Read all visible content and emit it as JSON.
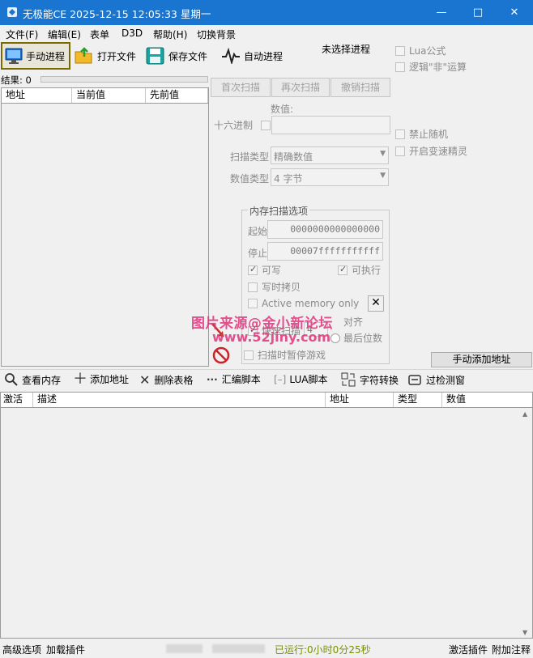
{
  "window": {
    "title": "无极能CE   2025-12-15 12:05:33 星期一",
    "minimize": "—",
    "maximize": "□",
    "close": "✕"
  },
  "menu": [
    "文件(F)",
    "编辑(E)",
    "表单",
    "D3D",
    "帮助(H)",
    "切换背景"
  ],
  "toolbar": {
    "manual_process": "手动进程",
    "open_file": "打开文件",
    "save_file": "保存文件",
    "auto_process": "自动进程",
    "process_status": "未选择进程"
  },
  "options_right": {
    "lua_formula": "Lua公式",
    "logic_not": "逻辑\"非\"运算",
    "disable_random": "禁止随机",
    "enable_speedhack": "开启变速精灵"
  },
  "results": {
    "label": "结果: 0"
  },
  "results_table": {
    "columns": [
      "地址",
      "当前值",
      "先前值"
    ]
  },
  "scan_buttons": {
    "first_scan": "首次扫描",
    "next_scan": "再次扫描",
    "undo_scan": "撤销扫描"
  },
  "scan": {
    "value_label": "数值:",
    "hex_label": "十六进制",
    "scan_type_label": "扫描类型",
    "scan_type_value": "精确数值",
    "value_type_label": "数值类型",
    "value_type_value": "4 字节"
  },
  "memory_options": {
    "legend": "内存扫描选项",
    "start_label": "起始",
    "start_value": "0000000000000000",
    "stop_label": "停止",
    "stop_value": "00007fffffffffff",
    "writable": "可写",
    "executable": "可执行",
    "copy_on_write": "写时拷贝",
    "active_memory": "Active memory only",
    "fast_scan": "快速扫描",
    "fast_scan_value": "4",
    "align": "对齐",
    "last_digits": "最后位数",
    "pause_game": "扫描时暂停游戏"
  },
  "add_manual": "手动添加地址",
  "watermark": {
    "line1": "图片来源@金小新论坛",
    "line2": "www.52jiny.com"
  },
  "bottom_toolbar": {
    "view_memory": "查看内存",
    "add_address": "添加地址",
    "delete_table": "删除表格",
    "asm_script": "汇编脚本",
    "lua_script": "LUA脚本",
    "char_convert": "字符转换",
    "bypass_detect": "过检测窗"
  },
  "address_table": {
    "columns": [
      "激活",
      "描述",
      "地址",
      "类型",
      "数值"
    ]
  },
  "statusbar": {
    "advanced": "高级选项",
    "load_plugin": "加载插件",
    "runtime": "已运行:0小时0分25秒",
    "activate_plugin": "激活插件",
    "add_note": "附加注释"
  },
  "colors": {
    "titlebar": "#1975cf",
    "runtime_text": "#7a8f00",
    "watermark": "#e0347c"
  }
}
